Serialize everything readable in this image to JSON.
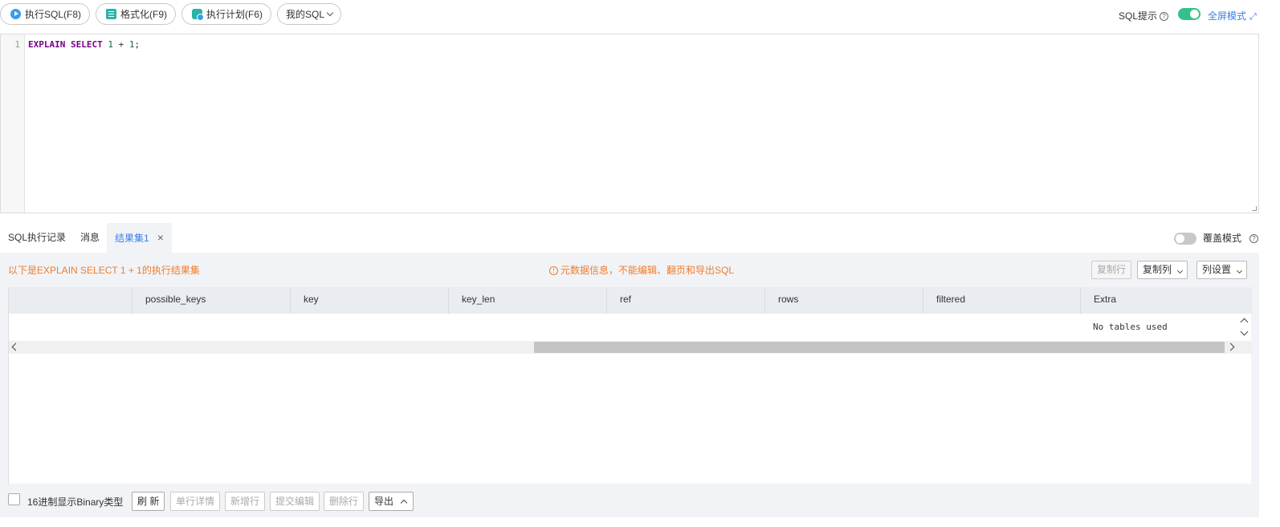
{
  "toolbar": {
    "run_sql": "执行SQL(F8)",
    "format": "格式化(F9)",
    "plan": "执行计划(F6)",
    "my_sql": "我的SQL",
    "sql_tip": "SQL提示",
    "fullscreen": "全屏模式",
    "sql_tip_enabled": true,
    "accent": "#3d7fe6",
    "toggle_color": "#35c08a"
  },
  "editor": {
    "line_number": "1",
    "tokens": {
      "kw1": "EXPLAIN",
      "kw2": "SELECT",
      "n1": "1",
      "op": "+",
      "n2": "1",
      "end": ";"
    }
  },
  "tabs": [
    {
      "label": "SQL执行记录"
    },
    {
      "label": "消息"
    },
    {
      "label": "结果集1",
      "active": true
    }
  ],
  "cover_mode": {
    "label": "覆盖模式",
    "enabled": false
  },
  "result": {
    "title": "以下是EXPLAIN SELECT 1 + 1的执行结果集",
    "warning": "元数据信息，不能编辑、翻页和导出SQL",
    "warning_color": "#f27c2a",
    "buttons": {
      "copy_row": "复制行",
      "copy_col": "复制列",
      "col_settings": "列设置"
    },
    "columns": [
      "possible_keys",
      "key",
      "key_len",
      "ref",
      "rows",
      "filtered",
      "Extra"
    ],
    "rows": [
      {
        "Extra": "No tables used"
      }
    ]
  },
  "footer": {
    "hex_binary_label": "16进制显示Binary类型",
    "hex_binary_checked": false,
    "refresh": "刷 新",
    "row_detail": "单行详情",
    "add_row": "新增行",
    "submit_edit": "提交编辑",
    "delete_row": "删除行",
    "export": "导出"
  }
}
